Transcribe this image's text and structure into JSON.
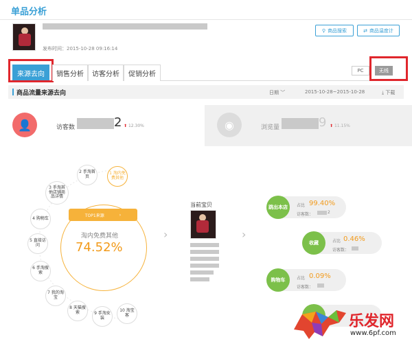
{
  "page": {
    "title": "单品分析"
  },
  "product": {
    "publish_label": "发布时间：2015-10-28  09:16:14"
  },
  "actions": {
    "search_label": "商品搜索",
    "stats_label": "商品温度计"
  },
  "tabs": [
    {
      "label": "来源去向",
      "active": true
    },
    {
      "label": "销售分析",
      "active": false
    },
    {
      "label": "访客分析",
      "active": false
    },
    {
      "label": "促销分析",
      "active": false
    }
  ],
  "device": {
    "pc_label": "PC",
    "wireless_label": "无线",
    "selected": "无线"
  },
  "section": {
    "title": "商品流量来源去向",
    "date_label": "日期",
    "date_range": "2015-10-28~2015-10-28",
    "download_label": "下载"
  },
  "stats": {
    "visitors": {
      "label": "访客数",
      "value_suffix": "2",
      "change": "12.30%"
    },
    "pageviews": {
      "label": "浏览量",
      "value_suffix": "9",
      "change": "11.15%"
    }
  },
  "sources": [
    {
      "label": "2 手淘首页"
    },
    {
      "label": "1 淘内免费其他"
    },
    {
      "label": "3 手淘其他店铺商品详情"
    },
    {
      "label": "4 购物车"
    },
    {
      "label": "5 直接访问"
    },
    {
      "label": "6 手淘搜索"
    },
    {
      "label": "7 我的淘宝"
    },
    {
      "label": "8 天猫搜索"
    },
    {
      "label": "9 手淘女装"
    },
    {
      "label": "10 淘宝客"
    }
  ],
  "top_source": {
    "badge": "TOP1来源",
    "name": "淘内免费其他",
    "percent": "74.52%"
  },
  "current_item": {
    "label": "当前宝贝"
  },
  "destinations": [
    {
      "tag": "跳出本店",
      "ratio_label": "占比",
      "ratio": "99.40%",
      "visit_label": "访客数：",
      "visit_suffix": "2"
    },
    {
      "tag": "收藏",
      "ratio_label": "占比",
      "ratio": "0.46%",
      "visit_label": "访客数：",
      "visit_suffix": ""
    },
    {
      "tag": "购物车",
      "ratio_label": "占比",
      "ratio": "0.09%",
      "visit_label": "访客数：",
      "visit_suffix": ""
    }
  ],
  "watermark": {
    "text": "乐发网",
    "url": "www.6pf.com"
  },
  "colors": {
    "accent": "#3aa0d6",
    "highlight": "#e0262c",
    "orange": "#f6b23a",
    "green": "#7cc04a"
  }
}
